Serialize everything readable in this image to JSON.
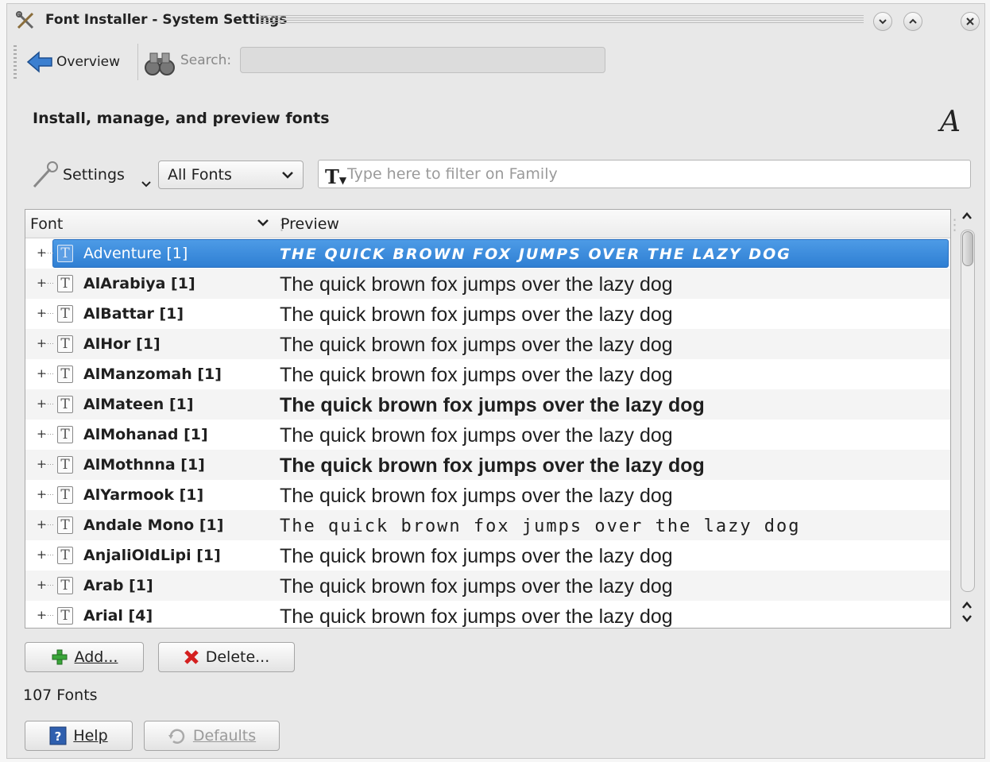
{
  "window": {
    "title": "Font Installer - System Settings"
  },
  "toolbar": {
    "overview_label": "Overview",
    "search_label": "Search:",
    "search_value": ""
  },
  "header": {
    "title": "Install, manage, and preview fonts",
    "glyph": "A"
  },
  "filter": {
    "settings_label": "Settings",
    "group_selected": "All Fonts",
    "placeholder": "Type here to filter on Family"
  },
  "table": {
    "columns": [
      "Font",
      "Preview"
    ],
    "rows": [
      {
        "name": "Adventure [1]",
        "preview": "The quick brown fox jumps over the lazy dog",
        "selected": true
      },
      {
        "name": "AlArabiya [1]",
        "preview": "The quick brown fox jumps over the lazy dog"
      },
      {
        "name": "AlBattar [1]",
        "preview": "The quick brown fox jumps over the lazy dog"
      },
      {
        "name": "AlHor [1]",
        "preview": "The quick brown fox jumps over the lazy dog"
      },
      {
        "name": "AlManzomah [1]",
        "preview": "The quick brown fox jumps over the lazy dog"
      },
      {
        "name": "AlMateen [1]",
        "preview": "The quick brown fox jumps over the lazy dog",
        "style": "bold"
      },
      {
        "name": "AlMohanad [1]",
        "preview": "The quick brown fox jumps over the lazy dog"
      },
      {
        "name": "AlMothnna [1]",
        "preview": "The quick brown fox jumps over the lazy dog",
        "style": "bold"
      },
      {
        "name": "AlYarmook [1]",
        "preview": "The quick brown fox jumps over the lazy dog"
      },
      {
        "name": "Andale Mono [1]",
        "preview": "The quick brown fox jumps over the lazy dog",
        "style": "mono"
      },
      {
        "name": "AnjaliOldLipi [1]",
        "preview": "The quick brown fox jumps over the lazy dog"
      },
      {
        "name": "Arab [1]",
        "preview": "The quick brown fox jumps over the lazy dog"
      },
      {
        "name": "Arial [4]",
        "preview": "The quick brown fox jumps over the lazy dog"
      }
    ]
  },
  "actions": {
    "add_label": "Add...",
    "delete_label": "Delete..."
  },
  "status": {
    "count_label": "107 Fonts"
  },
  "footer": {
    "help_label": "Help",
    "defaults_label": "Defaults"
  },
  "colors": {
    "selection": "#3a88dc",
    "add_icon": "#3aa63a",
    "delete_icon": "#d42020",
    "help_icon": "#2f5fae"
  }
}
